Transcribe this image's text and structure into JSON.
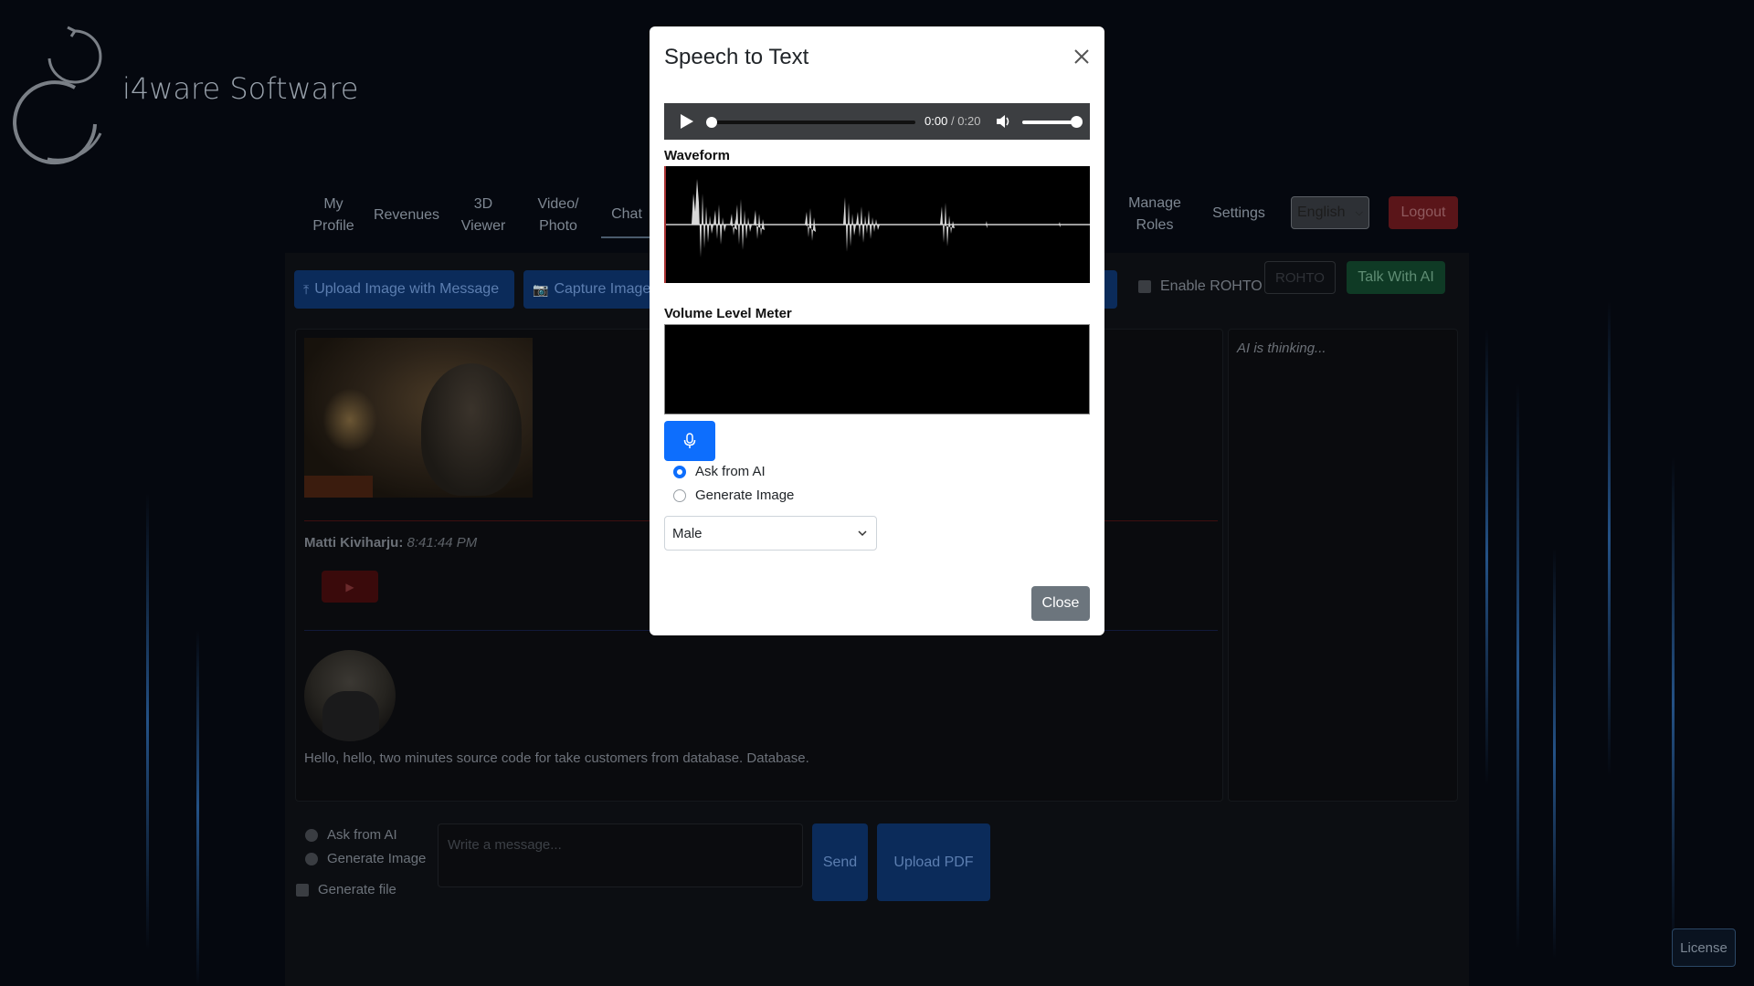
{
  "brand": {
    "name": "i4ware Software"
  },
  "nav": {
    "items": [
      {
        "line1": "My",
        "line2": "Profile"
      },
      {
        "line1": "Revenues",
        "line2": ""
      },
      {
        "line1": "3D",
        "line2": "Viewer"
      },
      {
        "line1": "Video/",
        "line2": "Photo"
      },
      {
        "line1": "Chat",
        "line2": ""
      }
    ],
    "right_items": [
      {
        "line1": "Manage",
        "line2": "Roles"
      },
      {
        "line1": "Settings",
        "line2": ""
      }
    ],
    "language": "English",
    "logout": "Logout"
  },
  "toolbar": {
    "upload_label": "Upload Image with Message",
    "capture_label": "Capture Image",
    "rohto_label": "Enable ROHTO",
    "rohto_button": "ROHTO",
    "talk_label": "Talk With AI"
  },
  "side": {
    "status": "AI is thinking..."
  },
  "chat": {
    "author": "Matti Kiviharju:",
    "time": "8:41:44 PM",
    "message": "Hello, hello, two minutes source code for take customers from database. Database."
  },
  "composer": {
    "radio_ask": "Ask from AI",
    "radio_generate": "Generate Image",
    "checkbox_file": "Generate file",
    "placeholder": "Write a message...",
    "send": "Send",
    "upload_pdf": "Upload PDF"
  },
  "license": "License",
  "modal": {
    "title": "Speech to Text",
    "player": {
      "current": "0:00",
      "separator": "/",
      "duration": "0:20"
    },
    "waveform_label": "Waveform",
    "meter_label": "Volume Level Meter",
    "radio_ask": "Ask from AI",
    "radio_generate": "Generate Image",
    "voice": "Male",
    "close": "Close"
  },
  "colors": {
    "primary": "#0d6efd",
    "secondary": "#6c757d",
    "danger_dim": "#5a1519",
    "success_dim": "#0f3a25"
  }
}
